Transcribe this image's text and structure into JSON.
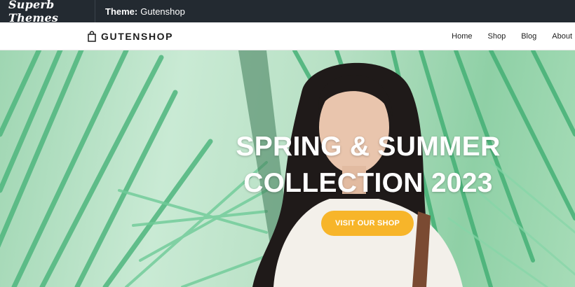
{
  "demo_bar": {
    "logo_text": "Superb Themes",
    "theme_label": "Theme:",
    "theme_name": "Gutenshop"
  },
  "header": {
    "brand": "GUTENSHOP",
    "nav": [
      "Home",
      "Shop",
      "Blog",
      "About"
    ]
  },
  "hero": {
    "title_line1": "SPRING & SUMMER",
    "title_line2": "COLLECTION 2023",
    "cta_label": "VISIT OUR SHOP"
  },
  "colors": {
    "demo_bar_bg": "#232a31",
    "cta_bg": "#f7b52a",
    "hero_leaf_green": "#5cc08a"
  }
}
